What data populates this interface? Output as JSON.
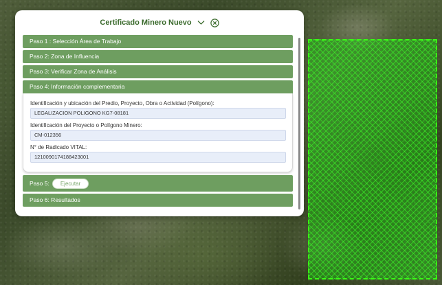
{
  "panel": {
    "title": "Certificado Minero Nuevo"
  },
  "icons": {
    "collapse": "chevron-down-icon",
    "close": "circle-close-icon"
  },
  "steps": [
    {
      "label": "Paso 1 : Selección Área de Trabajo"
    },
    {
      "label": "Paso 2: Zona de Influencia"
    },
    {
      "label": "Paso 3: Verificar Zona de Análisis"
    },
    {
      "label": "Paso 4: Información complementaria"
    },
    {
      "label": "Paso 5:"
    },
    {
      "label": "Paso 6: Resultados"
    }
  ],
  "step4": {
    "fields": [
      {
        "label": "Identificación y ubicación del Predio, Proyecto, Obra o Actividad (Polígono):",
        "value": "LEGALIZACION POLIGONO KG7-08181"
      },
      {
        "label": "Identificación del Proyecto o Polígono Minero:",
        "value": "CM-012356"
      },
      {
        "label": "N° de Radicado VITAL:",
        "value": "1210090174188423001"
      }
    ]
  },
  "step5": {
    "button_label": "Ejecutar"
  },
  "colors": {
    "step_bg": "#6e9e60",
    "accent": "#3a6a2c",
    "polygon": "#39ff14"
  }
}
